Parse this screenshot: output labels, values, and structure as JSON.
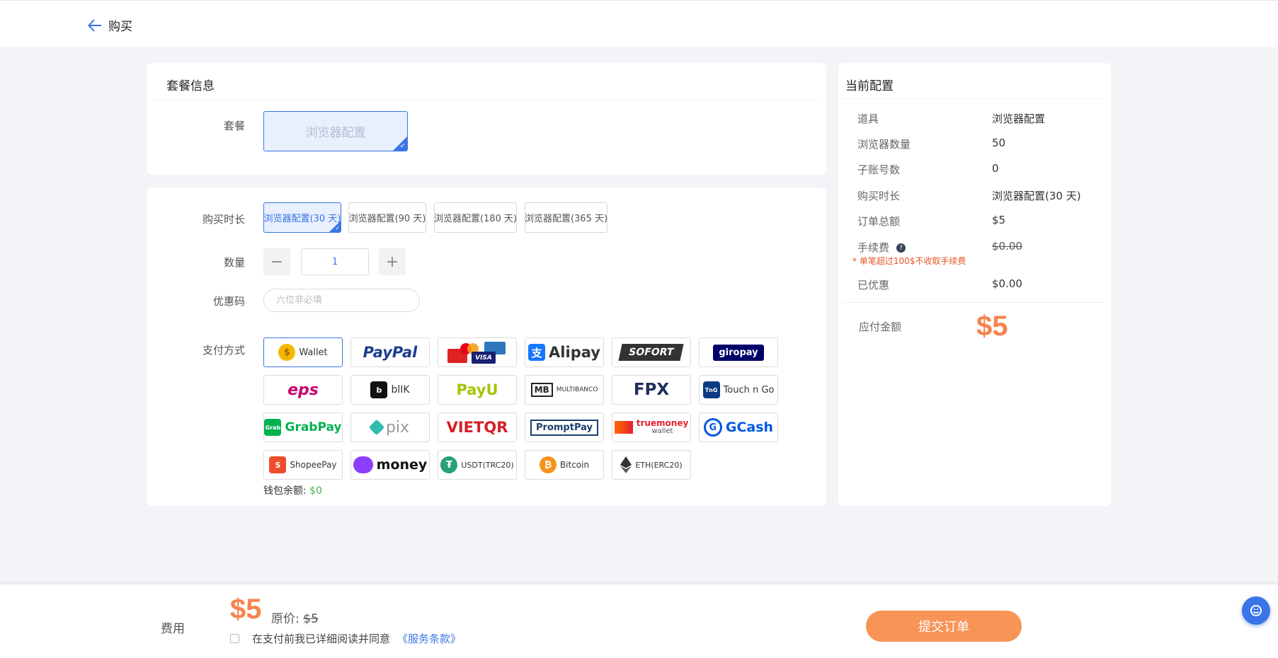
{
  "header": {
    "back_label": "购买"
  },
  "package": {
    "title": "套餐信息",
    "label": "套餐",
    "selected": "浏览器配置"
  },
  "purchase": {
    "duration_label": "购买时长",
    "durations": [
      "浏览器配置(30 天)",
      "浏览器配置(90 天)",
      "浏览器配置(180 天)",
      "浏览器配置(365 天)"
    ],
    "quantity_label": "数量",
    "quantity": "1",
    "quantity_minus": "−",
    "quantity_plus": "+",
    "coupon_label": "优惠码",
    "coupon_placeholder": "六位非必填",
    "payment_label": "支付方式",
    "payments": {
      "wallet": "Wallet",
      "paypal": "PayPal",
      "cards": "VISA",
      "alipay": "Alipay",
      "sofort": "SOFORT",
      "giropay": "giropay",
      "eps": "eps",
      "blik": "blIK",
      "payu": "PayU",
      "multibanco": "MULTIBANCO",
      "fpx": "FPX",
      "touchngo": "Touch n Go",
      "grabpay": "GrabPay",
      "pix": "pix",
      "vietqr": "VIETQR",
      "promptpay": "PromptPay",
      "truemoney": "truemoney",
      "truemoney_sub": "wallet",
      "gcash": "GCash",
      "shopeepay": "ShopeePay",
      "money": "money",
      "usdt": "USDT(TRC20)",
      "bitcoin": "Bitcoin",
      "eth": "ETH(ERC20)"
    },
    "wallet_balance_label": "钱包余额:",
    "wallet_balance": "$0"
  },
  "config": {
    "title": "当前配置",
    "rows": [
      {
        "k": "道具",
        "v": "浏览器配置"
      },
      {
        "k": "浏览器数量",
        "v": "50"
      },
      {
        "k": "子账号数",
        "v": "0"
      },
      {
        "k": "购买时长",
        "v": "浏览器配置(30 天)"
      },
      {
        "k": "订单总额",
        "v": "$5"
      },
      {
        "k": "手续费",
        "v": "$0.00"
      },
      {
        "k": "已优惠",
        "v": "$0.00"
      }
    ],
    "fee_note": "* 单笔超过100$不收取手续费",
    "due_label": "应付金额",
    "due_value": "$5"
  },
  "footer": {
    "fee_label": "费用",
    "fee_value": "$5",
    "original_label": "原价:",
    "original_price": "$5",
    "agree_text": "在支付前我已详细阅读并同意",
    "terms_link": "《服务条款》",
    "submit_label": "提交订单"
  },
  "colors": {
    "accent": "#3b74e8",
    "price": "#f7834e",
    "submit": "#f89456"
  }
}
